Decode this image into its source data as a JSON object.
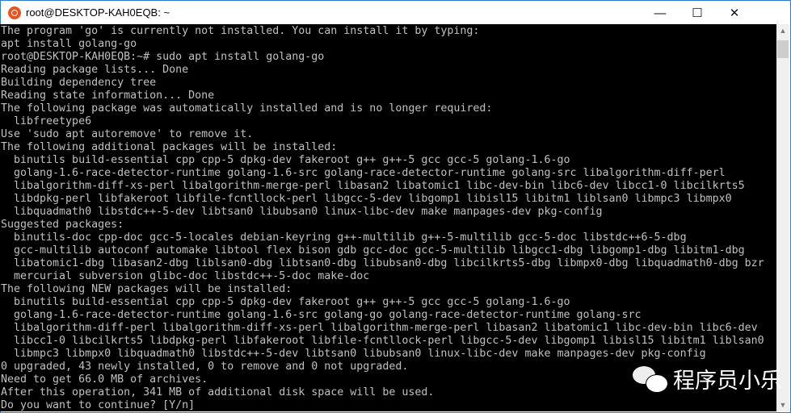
{
  "window": {
    "title": "root@DESKTOP-KAH0EQB: ~",
    "app_icon": "ubuntu-icon",
    "controls": {
      "minimize": "—",
      "maximize": "☐",
      "close": "✕"
    }
  },
  "terminal": {
    "lines": [
      "The program 'go' is currently not installed. You can install it by typing:",
      "apt install golang-go",
      "root@DESKTOP-KAH0EQB:~# sudo apt install golang-go",
      "Reading package lists... Done",
      "Building dependency tree",
      "Reading state information... Done",
      "The following package was automatically installed and is no longer required:",
      "  libfreetype6",
      "Use 'sudo apt autoremove' to remove it.",
      "The following additional packages will be installed:",
      "  binutils build-essential cpp cpp-5 dpkg-dev fakeroot g++ g++-5 gcc gcc-5 golang-1.6-go",
      "  golang-1.6-race-detector-runtime golang-1.6-src golang-race-detector-runtime golang-src libalgorithm-diff-perl",
      "  libalgorithm-diff-xs-perl libalgorithm-merge-perl libasan2 libatomic1 libc-dev-bin libc6-dev libcc1-0 libcilkrts5",
      "  libdpkg-perl libfakeroot libfile-fcntllock-perl libgcc-5-dev libgomp1 libisl15 libitm1 liblsan0 libmpc3 libmpx0",
      "  libquadmath0 libstdc++-5-dev libtsan0 libubsan0 linux-libc-dev make manpages-dev pkg-config",
      "Suggested packages:",
      "  binutils-doc cpp-doc gcc-5-locales debian-keyring g++-multilib g++-5-multilib gcc-5-doc libstdc++6-5-dbg",
      "  gcc-multilib autoconf automake libtool flex bison gdb gcc-doc gcc-5-multilib libgcc1-dbg libgomp1-dbg libitm1-dbg",
      "  libatomic1-dbg libasan2-dbg liblsan0-dbg libtsan0-dbg libubsan0-dbg libcilkrts5-dbg libmpx0-dbg libquadmath0-dbg bzr",
      "  mercurial subversion glibc-doc libstdc++-5-doc make-doc",
      "The following NEW packages will be installed:",
      "  binutils build-essential cpp cpp-5 dpkg-dev fakeroot g++ g++-5 gcc gcc-5 golang-1.6-go",
      "  golang-1.6-race-detector-runtime golang-1.6-src golang-go golang-race-detector-runtime golang-src",
      "  libalgorithm-diff-perl libalgorithm-diff-xs-perl libalgorithm-merge-perl libasan2 libatomic1 libc-dev-bin libc6-dev",
      "  libcc1-0 libcilkrts5 libdpkg-perl libfakeroot libfile-fcntllock-perl libgcc-5-dev libgomp1 libisl15 libitm1 liblsan0",
      "  libmpc3 libmpx0 libquadmath0 libstdc++-5-dev libtsan0 libubsan0 linux-libc-dev make manpages-dev pkg-config",
      "0 upgraded, 43 newly installed, 0 to remove and 0 not upgraded.",
      "Need to get 66.0 MB of archives.",
      "After this operation, 341 MB of additional disk space will be used.",
      "Do you want to continue? [Y/n]"
    ]
  },
  "watermark": {
    "icon": "wechat-icon",
    "text": "程序员小乐"
  }
}
